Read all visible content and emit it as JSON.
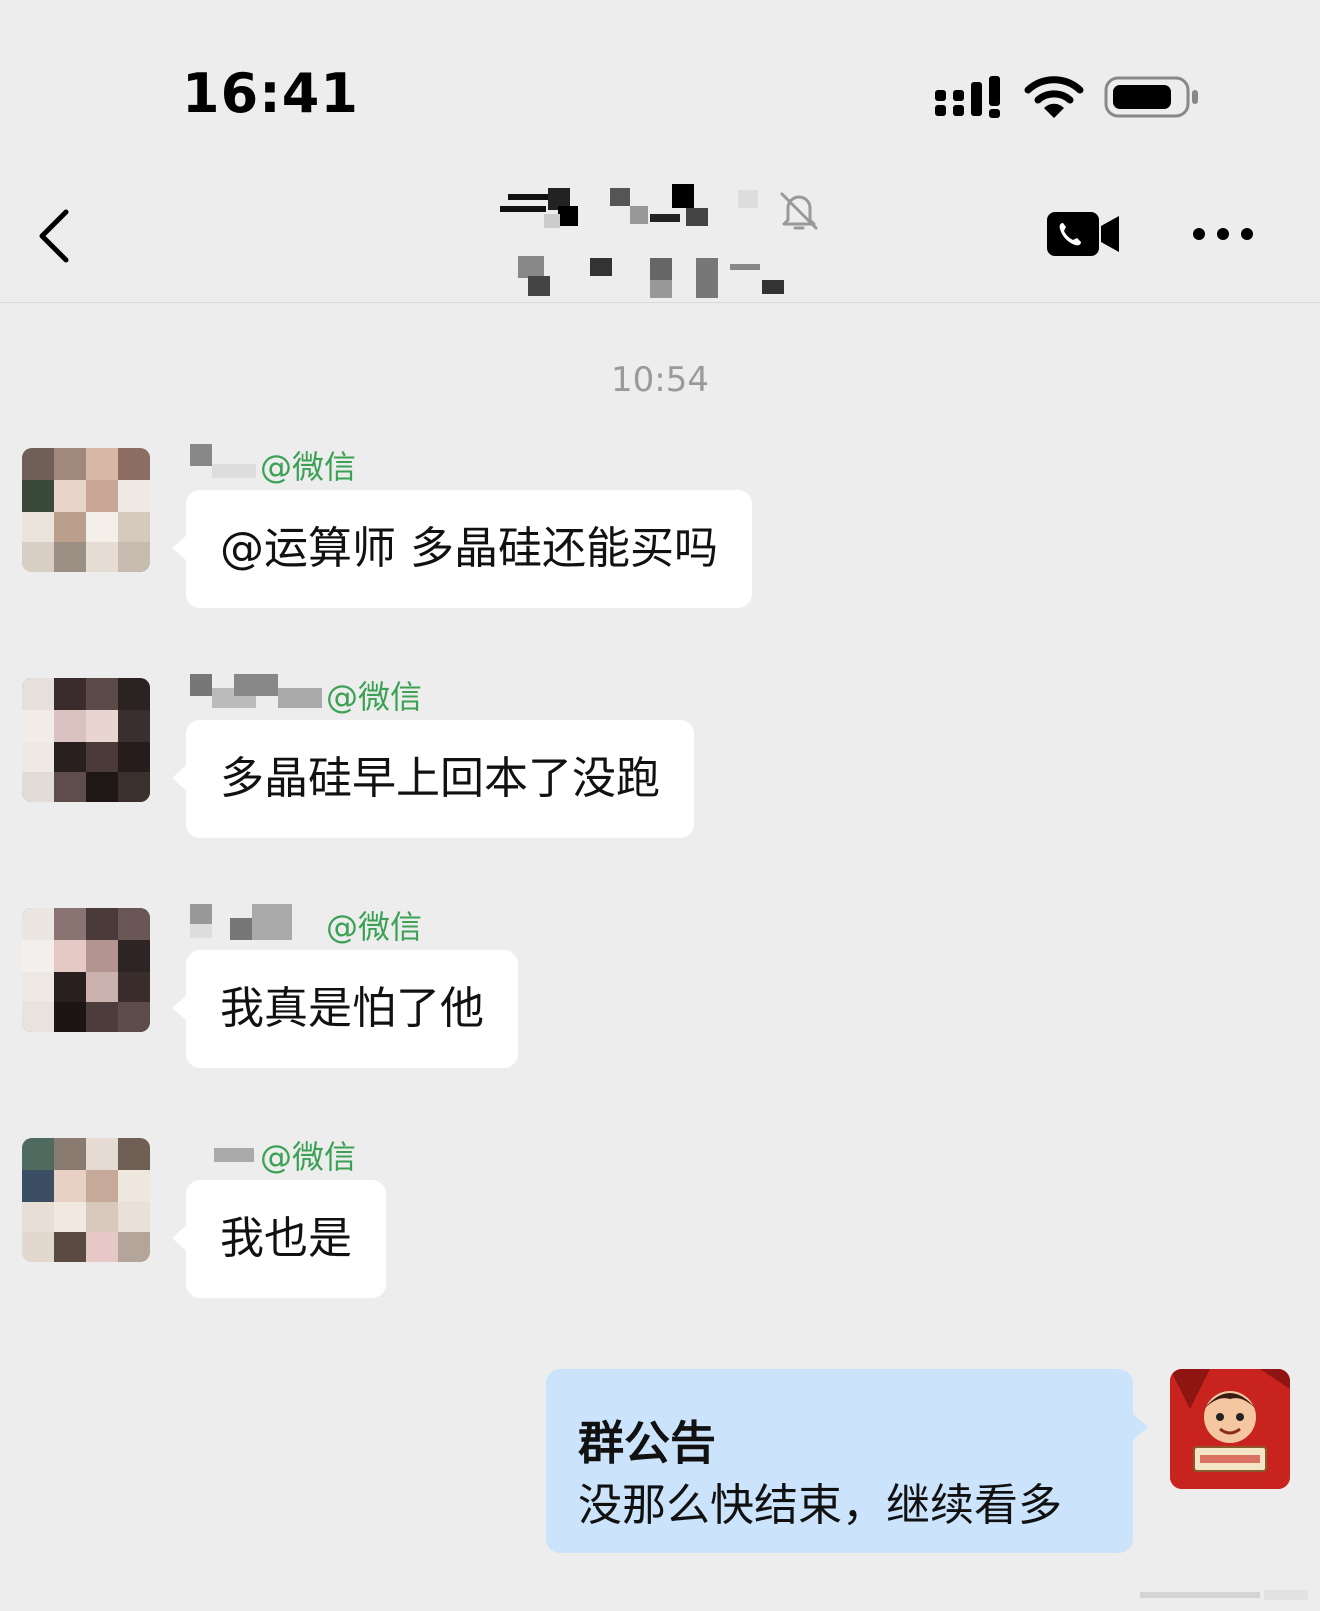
{
  "status_bar": {
    "time": "16:41",
    "icons": [
      "signal-icon",
      "wifi-icon",
      "battery-icon"
    ]
  },
  "nav": {
    "icons": [
      "back-icon",
      "mute-icon",
      "video-call-icon",
      "more-icon"
    ]
  },
  "chat": {
    "timestamp": "10:54",
    "messages": [
      {
        "sender_suffix": "@微信",
        "text": "@运算师 多晶硅还能买吗"
      },
      {
        "sender_suffix": "@微信",
        "text": "多晶硅早上回本了没跑"
      },
      {
        "sender_suffix": "@微信",
        "text": "我真是怕了他"
      },
      {
        "sender_suffix": "@微信",
        "text": "我也是"
      }
    ],
    "announcement": {
      "title": "群公告",
      "body": "没那么快结束，继续看多"
    }
  },
  "colors": {
    "background": "#ededed",
    "bubble_incoming": "#ffffff",
    "bubble_notice": "#cce4fb",
    "sender_green": "#3ba154",
    "timestamp_gray": "#9a9a9a"
  }
}
